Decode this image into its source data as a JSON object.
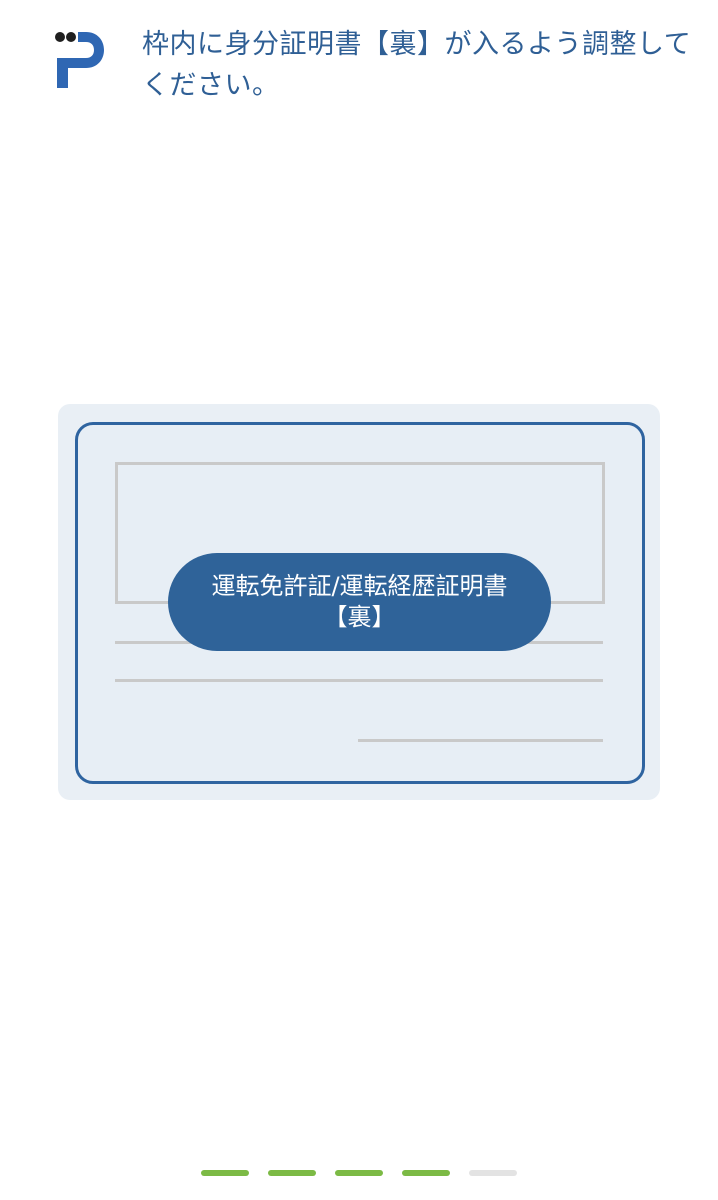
{
  "header": {
    "logo_icon": "p-logo-icon",
    "instruction_line1": "枠内に身分証明書【裏】が入るよう調整して",
    "instruction_line2": "ください。"
  },
  "card_guide": {
    "document_label_line1": "運転免許証/運転経歴証明書",
    "document_label_line2": "【裏】"
  },
  "progress": {
    "total_steps": 5,
    "current_step": 4,
    "completed_color": "#7cba45",
    "pending_color": "#e3e3e3"
  },
  "colors": {
    "accent": "#2f6399",
    "text_blue": "#2f5f95",
    "card_background": "#e9eff5"
  }
}
